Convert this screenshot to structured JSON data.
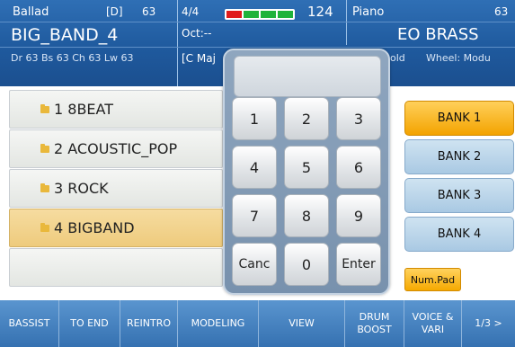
{
  "header": {
    "style_category": "Ballad",
    "style_flag": "[D]",
    "style_number": "63",
    "style_name": "BIG_BAND_4",
    "style_mix": "Dr 63  Bs 63  Ch 63  Lw 63",
    "time_signature": "4/4",
    "octave": "Oct:--",
    "key": "[C Maj",
    "tempo": "124",
    "beat_colors": [
      "#e01b1b",
      "#1fb33a",
      "#1fb33a",
      "#1fb33a"
    ],
    "voice_category": "Piano",
    "voice_number": "63",
    "voice_name": "EO BRASS",
    "voice_hold": "old",
    "voice_wheel": "Wheel: Modu"
  },
  "style_list": {
    "items": [
      {
        "label": "1 8BEAT",
        "selected": false
      },
      {
        "label": "2 ACOUSTIC_POP",
        "selected": false
      },
      {
        "label": "3 ROCK",
        "selected": false
      },
      {
        "label": "4 BIGBAND",
        "selected": true
      }
    ]
  },
  "numpad": {
    "display": "",
    "keys": [
      "1",
      "2",
      "3",
      "4",
      "5",
      "6",
      "7",
      "8",
      "9",
      "Canc",
      "0",
      "Enter"
    ]
  },
  "banks": {
    "buttons": [
      "BANK 1",
      "BANK 2",
      "BANK 3",
      "BANK 4"
    ],
    "active_index": 0,
    "numpad_toggle": "Num.Pad"
  },
  "bottom_bar": {
    "buttons": [
      "BASSIST",
      "TO END",
      "REINTRO",
      "MODELING",
      "VIEW",
      "DRUM\nBOOST",
      "VOICE &\nVARI",
      "1/3 >"
    ]
  },
  "colors": {
    "header_blue": "#1f5a9e",
    "selected_row": "#eecb7d",
    "active_bank": "#f3a300",
    "bank_blue": "#a9c9e3"
  }
}
